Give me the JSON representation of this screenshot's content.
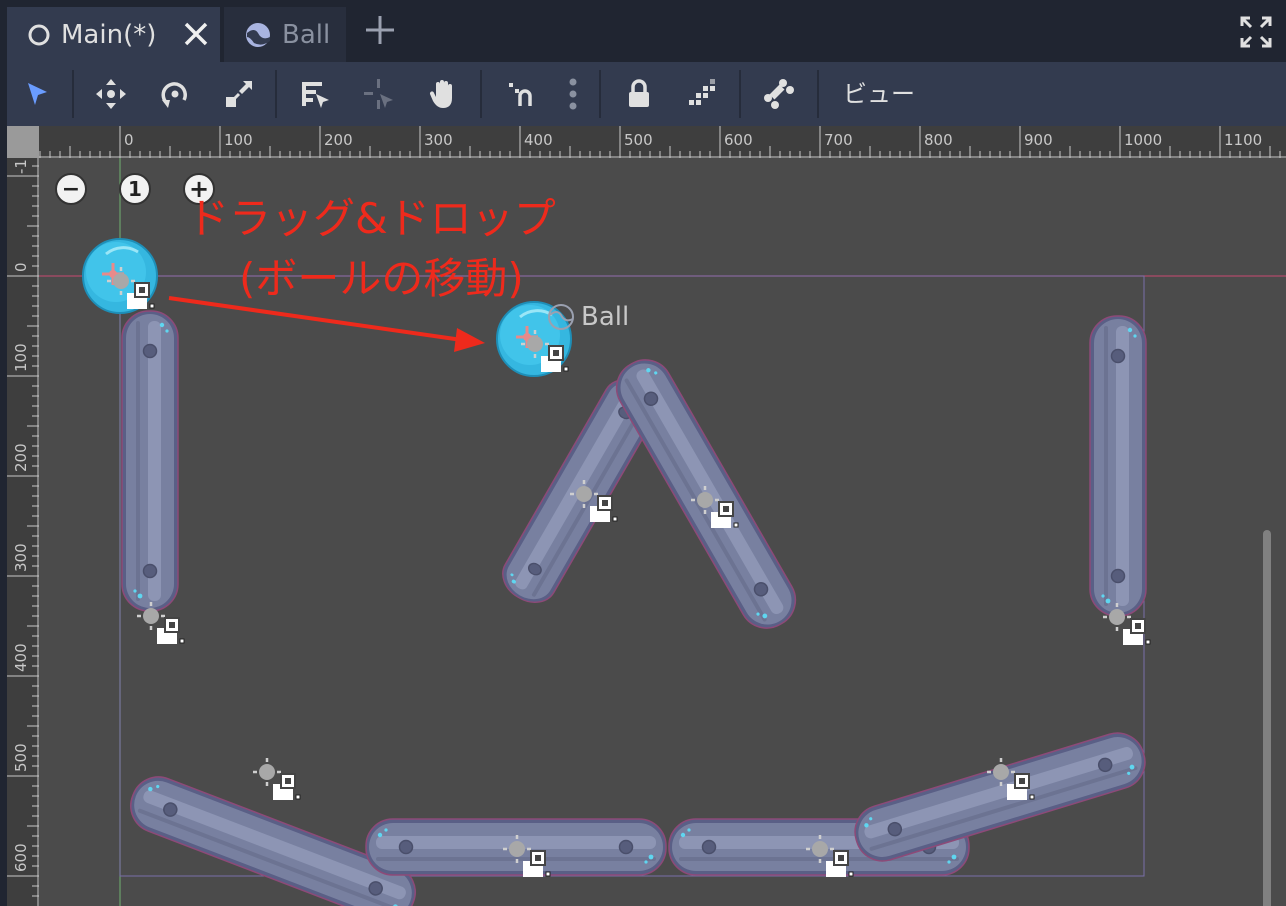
{
  "tabs": [
    {
      "label": "Main(*)",
      "icon": "node2d-circle-icon",
      "active": true,
      "closable": true
    },
    {
      "label": "Ball",
      "icon": "globe-icon",
      "active": false
    }
  ],
  "toolbar": {
    "tools": [
      "select-tool",
      "move-tool",
      "rotate-tool",
      "scale-tool",
      "list-select-tool",
      "pivot-tool",
      "pan-tool",
      "smart-snap-tool",
      "snap-options",
      "lock-tool",
      "group-tool",
      "skeleton-tool"
    ],
    "view_label": "ビュー",
    "accent_color": "#6a9cff"
  },
  "rulers": {
    "top_labels": [
      "0",
      "100",
      "200",
      "300",
      "400",
      "500",
      "600",
      "700",
      "800",
      "900",
      "1000",
      "1100"
    ],
    "left_labels": [
      "-1",
      "0",
      "100",
      "200",
      "300",
      "400",
      "500",
      "600"
    ]
  },
  "zoom": {
    "minus": "−",
    "reset": "1",
    "plus": "+"
  },
  "annotation": {
    "line1": "ドラッグ&ドロップ",
    "line2": "(ボールの移動)",
    "color": "#ee2a1c"
  },
  "ball_label": "Ball",
  "colors": {
    "viewport_bg": "#4b4b4b",
    "bar_fill": "#7880a0",
    "ball": "#35b7e0"
  }
}
